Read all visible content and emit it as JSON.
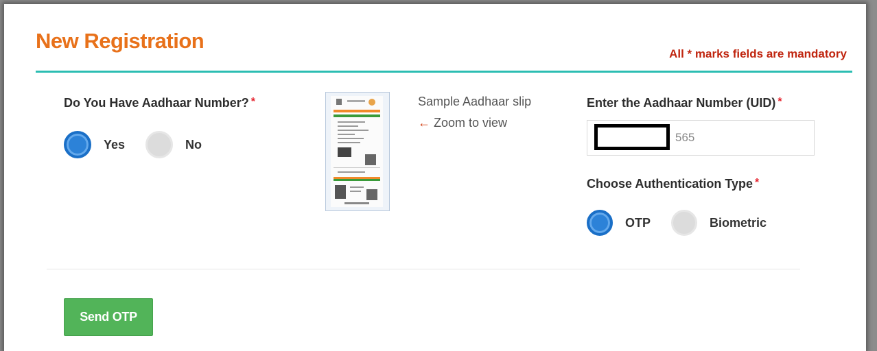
{
  "page": {
    "title": "New Registration",
    "mandatory_note": "All * marks fields are mandatory"
  },
  "aadhaar_question": {
    "label": "Do You Have Aadhaar Number?",
    "required_mark": "*",
    "options": [
      {
        "label": "Yes",
        "selected": true
      },
      {
        "label": "No",
        "selected": false
      }
    ]
  },
  "sample_slip": {
    "caption": "Sample Aadhaar slip",
    "zoom_arrow": "←",
    "zoom_text": "Zoom to view"
  },
  "uid_field": {
    "label": "Enter the Aadhaar Number (UID)",
    "required_mark": "*",
    "value": "565"
  },
  "auth_type": {
    "label": "Choose Authentication Type",
    "required_mark": "*",
    "options": [
      {
        "label": "OTP",
        "selected": true
      },
      {
        "label": "Biometric",
        "selected": false
      }
    ]
  },
  "actions": {
    "send_otp_label": "Send OTP"
  },
  "colors": {
    "title": "#e8711a",
    "mandatory_note": "#c0250f",
    "accent_line": "#2bbdb2",
    "radio_selected": "#2c82d8",
    "button": "#52b459"
  }
}
